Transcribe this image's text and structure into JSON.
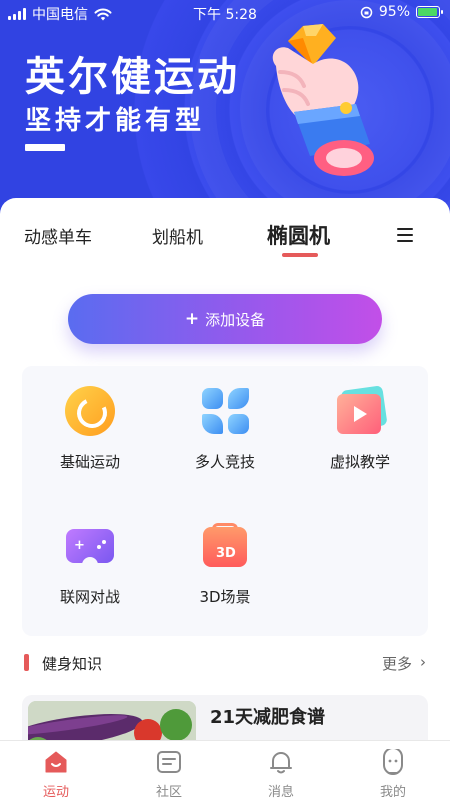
{
  "status_bar": {
    "carrier": "中国电信",
    "time": "下午 5:28",
    "battery": "95%",
    "battery_level": 0.95
  },
  "hero": {
    "title": "英尔健运动",
    "subtitle": "坚持才能有型"
  },
  "tabs": [
    {
      "label": "动感单车",
      "active": false
    },
    {
      "label": "划船机",
      "active": false
    },
    {
      "label": "椭圆机",
      "active": true
    }
  ],
  "add_device": {
    "label": "添加设备",
    "icon": "plus-icon"
  },
  "features": [
    {
      "label": "基础运动",
      "icon": "basic-workout-icon"
    },
    {
      "label": "多人竞技",
      "icon": "multiplayer-icon"
    },
    {
      "label": "虚拟教学",
      "icon": "video-play-icon"
    },
    {
      "label": "联网对战",
      "icon": "gamepad-icon"
    },
    {
      "label": "3D场景",
      "icon": "3d-box-icon",
      "icon_text": "3D"
    }
  ],
  "section": {
    "title": "健身知识",
    "more": "更多"
  },
  "article": {
    "title": "21天减肥食谱"
  },
  "bottom_nav": [
    {
      "label": "运动",
      "icon": "sport-home-icon",
      "active": true
    },
    {
      "label": "社区",
      "icon": "community-icon",
      "active": false
    },
    {
      "label": "消息",
      "icon": "bell-icon",
      "active": false
    },
    {
      "label": "我的",
      "icon": "profile-icon",
      "active": false
    }
  ],
  "colors": {
    "hero_blue": "#3848ea",
    "accent_red": "#e55a5a",
    "button_gradient_start": "#5a6cf0",
    "button_gradient_end": "#c24fe8"
  }
}
